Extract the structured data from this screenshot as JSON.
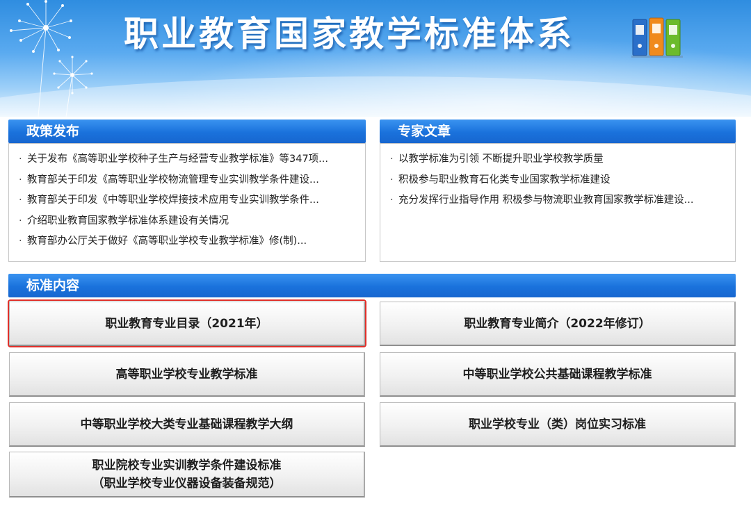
{
  "banner": {
    "title": "职业教育国家教学标准体系"
  },
  "policy": {
    "title": "政策发布",
    "items": [
      "关于发布《高等职业学校种子生产与经营专业教学标准》等347项...",
      "教育部关于印发《高等职业学校物流管理专业实训教学条件建设...",
      "教育部关于印发《中等职业学校焊接技术应用专业实训教学条件...",
      "介绍职业教育国家教学标准体系建设有关情况",
      "教育部办公厅关于做好《高等职业学校专业教学标准》修(制)..."
    ]
  },
  "expert": {
    "title": "专家文章",
    "items": [
      "以教学标准为引领 不断提升职业学校教学质量",
      "积极参与职业教育石化类专业国家教学标准建设",
      "充分发挥行业指导作用 积极参与物流职业教育国家教学标准建设..."
    ]
  },
  "standards": {
    "title": "标准内容",
    "buttons": [
      "职业教育专业目录（2021年）",
      "职业教育专业简介（2022年修订）",
      "高等职业学校专业教学标准",
      "中等职业学校公共基础课程教学标准",
      "中等职业学校大类专业基础课程教学大纲",
      "职业学校专业（类）岗位实习标准",
      "职业院校专业实训教学条件建设标准",
      "（职业学校专业仪器设备装备规范）"
    ]
  },
  "colors": {
    "header_blue": "#1a72dc",
    "highlight_red": "#e0302a"
  }
}
